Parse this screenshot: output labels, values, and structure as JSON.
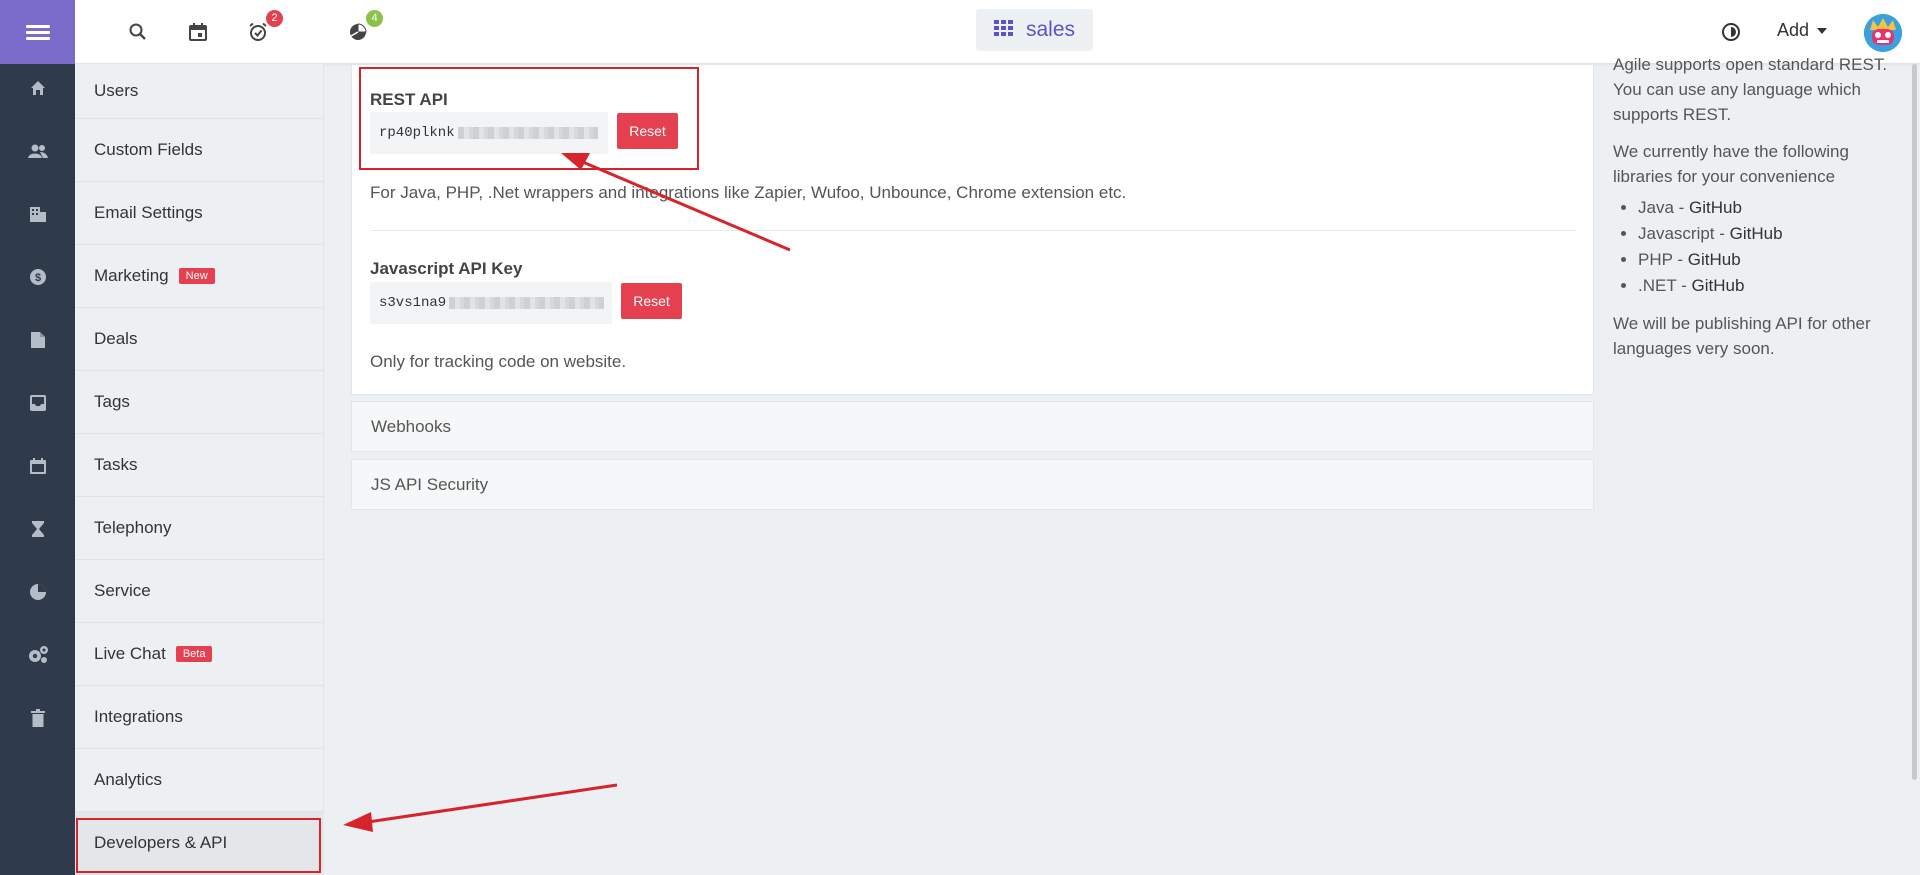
{
  "header": {
    "workspace_label": "sales",
    "add_label": "Add",
    "reminders_count": "2",
    "reports_count": "4"
  },
  "menu": {
    "items": [
      {
        "label": "Users"
      },
      {
        "label": "Custom Fields"
      },
      {
        "label": "Email Settings"
      },
      {
        "label": "Marketing",
        "tag": "New"
      },
      {
        "label": "Deals"
      },
      {
        "label": "Tags"
      },
      {
        "label": "Tasks"
      },
      {
        "label": "Telephony"
      },
      {
        "label": "Service"
      },
      {
        "label": "Live Chat",
        "tag": "Beta"
      },
      {
        "label": "Integrations"
      },
      {
        "label": "Analytics"
      },
      {
        "label": "Developers & API"
      }
    ]
  },
  "api": {
    "rest_title": "REST API",
    "rest_key": "rp40plknk",
    "rest_reset": "Reset",
    "rest_desc": "For Java, PHP, .Net wrappers and integrations like Zapier, Wufoo, Unbounce, Chrome extension etc.",
    "js_title": "Javascript API Key",
    "js_key": "s3vs1na9",
    "js_reset": "Reset",
    "js_desc": "Only for tracking code on website."
  },
  "sections": {
    "webhooks": "Webhooks",
    "js_security": "JS API Security"
  },
  "info": {
    "intro": "Agile supports open standard REST. You can use any language which supports REST.",
    "libraries_intro": "We currently have the following libraries for your convenience",
    "libraries": [
      {
        "lang": "Java",
        "link": "GitHub"
      },
      {
        "lang": "Javascript",
        "link": "GitHub"
      },
      {
        "lang": "PHP",
        "link": "GitHub"
      },
      {
        "lang": ".NET",
        "link": "GitHub"
      }
    ],
    "outro": "We will be publishing API for other languages very soon."
  },
  "icons": {
    "menu": "hamburger-icon",
    "search": "search-icon",
    "calendar": "calendar-icon",
    "reminder": "alarm-icon",
    "reports": "pie-chart-icon",
    "theme": "contrast-icon",
    "workspace": "grid-icon"
  },
  "colors": {
    "brand": "#7b6ccb",
    "rail": "#2f3a4a",
    "danger": "#e4404f",
    "annotation": "#d7242c"
  }
}
